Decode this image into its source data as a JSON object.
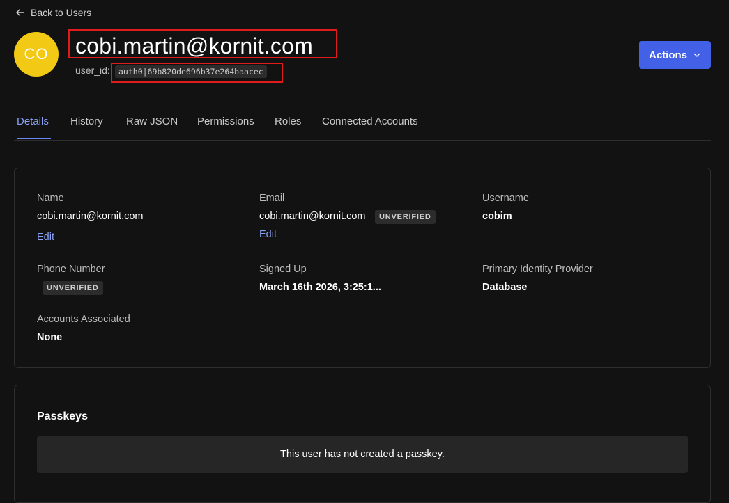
{
  "nav": {
    "back_label": "Back to Users"
  },
  "user": {
    "initials": "CO",
    "avatar_color": "#f2c915",
    "title": "cobi.martin@kornit.com",
    "user_id_label": "user_id:",
    "user_id": "auth0|69b820de696b37e264baacec"
  },
  "actions": {
    "label": "Actions",
    "color": "#4361e6"
  },
  "tabs": [
    {
      "label": "Details",
      "active": true
    },
    {
      "label": "History",
      "active": false
    },
    {
      "label": "Raw JSON",
      "active": false
    },
    {
      "label": "Permissions",
      "active": false
    },
    {
      "label": "Roles",
      "active": false
    },
    {
      "label": "Connected Accounts",
      "active": false
    }
  ],
  "details": {
    "name_label": "Name",
    "name_value": "cobi.martin@kornit.com",
    "name_edit": "Edit",
    "email_label": "Email",
    "email_value": "cobi.martin@kornit.com",
    "email_badge": "UNVERIFIED",
    "email_edit": "Edit",
    "username_label": "Username",
    "username_value": "cobim",
    "phone_label": "Phone Number",
    "phone_badge": "UNVERIFIED",
    "signed_up_label": "Signed Up",
    "signed_up_value": "March 16th 2026, 3:25:1...",
    "provider_label": "Primary Identity Provider",
    "provider_value": "Database",
    "accounts_label": "Accounts Associated",
    "accounts_value": "None"
  },
  "passkeys": {
    "title": "Passkeys",
    "empty_message": "This user has not created a passkey."
  }
}
